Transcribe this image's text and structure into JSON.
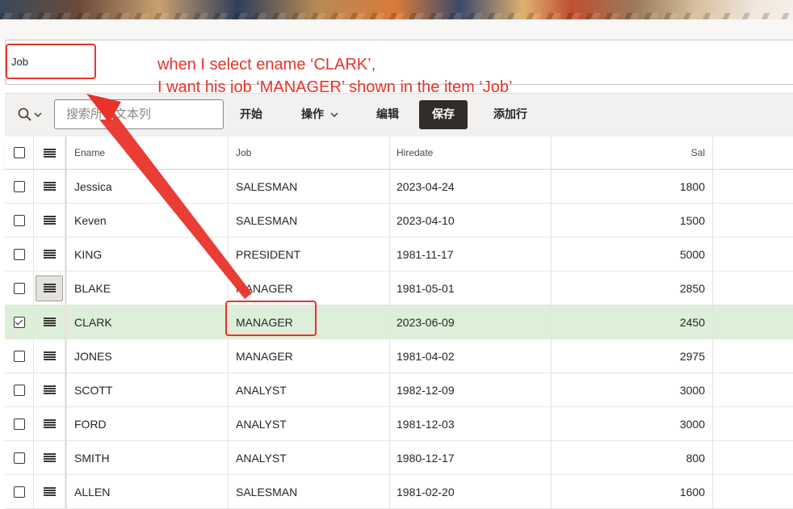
{
  "region": {
    "job_label": "Job"
  },
  "annotation": {
    "line1": "when I select ename ‘CLARK’,",
    "line2": "I want his job ‘MANAGER’ shown in the item ‘Job’"
  },
  "toolbar": {
    "search_placeholder": "搜索所有文本列",
    "go_label": "开始",
    "actions_label": "操作",
    "edit_label": "编辑",
    "save_label": "保存",
    "add_row_label": "添加行"
  },
  "grid": {
    "columns": [
      "Ename",
      "Job",
      "Hiredate",
      "Sal"
    ],
    "rows": [
      {
        "ename": "Jessica",
        "job": "SALESMAN",
        "hiredate": "2023-04-24",
        "sal": "1800"
      },
      {
        "ename": "Keven",
        "job": "SALESMAN",
        "hiredate": "2023-04-10",
        "sal": "1500"
      },
      {
        "ename": "KING",
        "job": "PRESIDENT",
        "hiredate": "1981-11-17",
        "sal": "5000"
      },
      {
        "ename": "BLAKE",
        "job": "MANAGER",
        "hiredate": "1981-05-01",
        "sal": "2850"
      },
      {
        "ename": "CLARK",
        "job": "MANAGER",
        "hiredate": "2023-06-09",
        "sal": "2450"
      },
      {
        "ename": "JONES",
        "job": "MANAGER",
        "hiredate": "1981-04-02",
        "sal": "2975"
      },
      {
        "ename": "SCOTT",
        "job": "ANALYST",
        "hiredate": "1982-12-09",
        "sal": "3000"
      },
      {
        "ename": "FORD",
        "job": "ANALYST",
        "hiredate": "1981-12-03",
        "sal": "3000"
      },
      {
        "ename": "SMITH",
        "job": "ANALYST",
        "hiredate": "1980-12-17",
        "sal": "800"
      },
      {
        "ename": "ALLEN",
        "job": "SALESMAN",
        "hiredate": "1981-02-20",
        "sal": "1600"
      }
    ]
  },
  "colors": {
    "annotation_red": "#e8332a",
    "selected_row": "#ddefd8",
    "save_button": "#312d2a"
  }
}
